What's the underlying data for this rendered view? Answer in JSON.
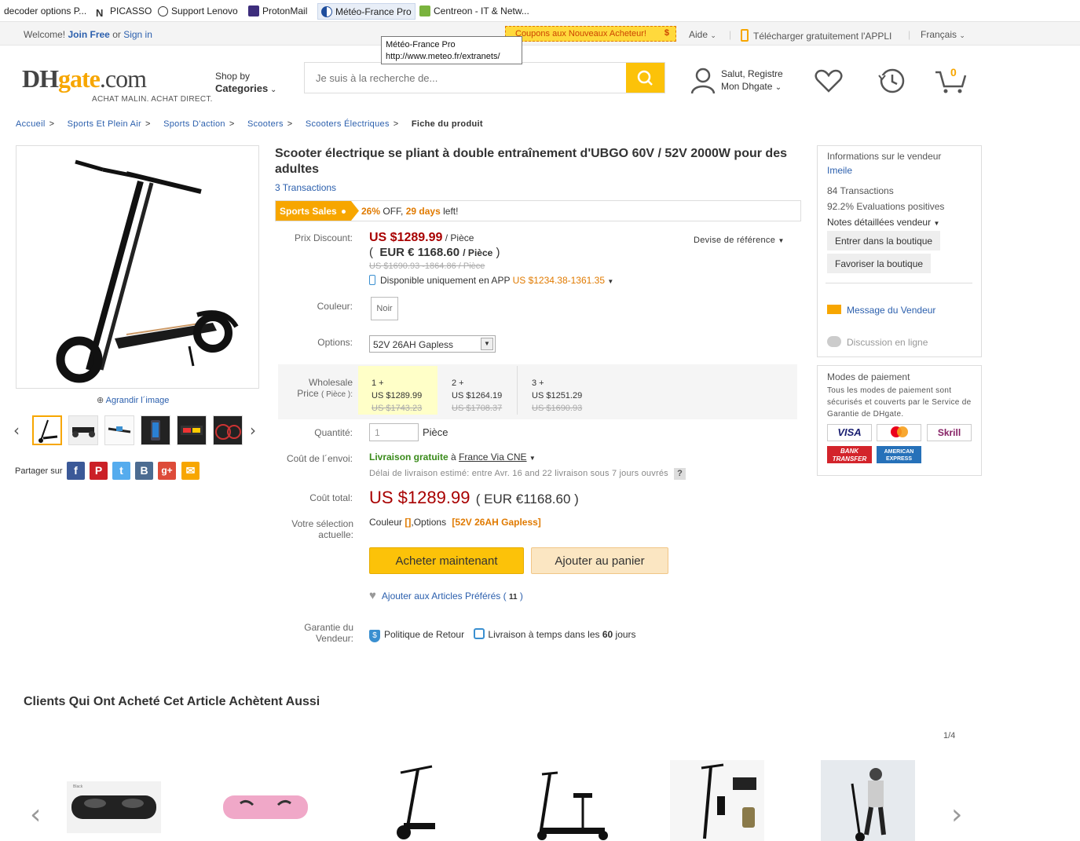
{
  "bookmarks": [
    {
      "label": "decoder options P...",
      "icon": "none"
    },
    {
      "label": "PICASSO",
      "icon": "n-logo-icon"
    },
    {
      "label": "Support Lenovo",
      "icon": "globe-icon"
    },
    {
      "label": "ProtonMail",
      "icon": "protonmail-icon"
    },
    {
      "label": "Météo-France Pro",
      "icon": "meteo-icon"
    },
    {
      "label": "Centreon - IT & Netw...",
      "icon": "centreon-icon"
    }
  ],
  "tooltip": {
    "title": "Météo-France Pro",
    "url": "http://www.meteo.fr/extranets/"
  },
  "topbar": {
    "welcome": "Welcome!",
    "join": "Join Free",
    "or": "or",
    "signin": "Sign in",
    "coupon": "Coupons aux Nouveaux Acheteur!",
    "coupon_icon": "$",
    "help": "Aide",
    "app": "Télécharger gratuitement l'APPLI",
    "language": "Français"
  },
  "header": {
    "logo_dh": "DH",
    "logo_g": "gate",
    "logo_com": ".com",
    "tagline": "ACHAT MALIN. ACHAT DIRECT.",
    "shop_by": "Shop by",
    "categories": "Categories",
    "search_placeholder": "Je suis à la recherche de...",
    "greeting": "Salut, Registre",
    "my_dhgate": "Mon Dhgate",
    "cart_count": "0"
  },
  "breadcrumb": [
    "Accueil",
    "Sports Et Plein Air",
    "Sports D'action",
    "Scooters",
    "Scooters Électriques",
    "Fiche du produit"
  ],
  "gallery": {
    "zoom": "Agrandir l´image",
    "share": "Partager sur"
  },
  "product": {
    "title": "Scooter électrique se pliant à double entraînement d'UBGO 60V / 52V 2000W pour des adultes",
    "transactions": "3 Transactions",
    "sale_tag": "Sports Sales",
    "sale_pct": "26%",
    "sale_off": "OFF,",
    "sale_days": "29 days",
    "sale_left": "left!",
    "price_label": "Prix Discount:",
    "price": "US $1289.99",
    "per": "/ Pièce",
    "price_eur": "EUR € 1168.60",
    "per_eur": "/ Pièce",
    "old_price": "US $1690.93 -1864.86 / Pièce",
    "currency_ref": "Devise de référence",
    "app_only": "Disponible uniquement en APP",
    "app_price": "US $1234.38-1361.35",
    "color_label": "Couleur:",
    "color_value": "Noir",
    "options_label": "Options:",
    "options_value": "52V 26AH Gapless",
    "wholesale_label": "Wholesale",
    "wholesale_label2": "Price",
    "wholesale_unit": "( Pièce ):",
    "tiers": [
      {
        "qty": "1 +",
        "price": "US $1289.99",
        "old": "US $1743.23"
      },
      {
        "qty": "2 +",
        "price": "US $1264.19",
        "old": "US $1708.37"
      },
      {
        "qty": "3 +",
        "price": "US $1251.29",
        "old": "US $1690.93"
      }
    ],
    "qty_label": "Quantité:",
    "qty_value": "1",
    "qty_unit": "Pièce",
    "ship_label": "Coût de l´envoi:",
    "free_ship": "Livraison gratuite",
    "ship_to": "à",
    "ship_dest": "France Via CNE",
    "delivery": "Délai de livraison estimé: entre Avr. 16 and 22 livraison sous 7 jours ouvrés",
    "total_label": "Coût total:",
    "total": "US $1289.99",
    "total_eur": "( EUR €1168.60 )",
    "selection_label": "Votre sélection actuelle:",
    "sel_color": "Couleur",
    "sel_color_val": "[]",
    "sel_opts": ",Options",
    "sel_opts_val": "[52V 26AH Gapless]",
    "buy_now": "Acheter maintenant",
    "add_cart": "Ajouter au panier",
    "wishlist": "Ajouter aux Articles Préférés",
    "wishlist_count": "11",
    "guarantee_label": "Garantie du Vendeur:",
    "return_policy": "Politique de Retour",
    "ontime": "Livraison à temps dans les",
    "ontime_days": "60",
    "ontime_unit": "jours"
  },
  "seller": {
    "heading": "Informations sur le vendeur",
    "name": "Imeile",
    "transactions": "84 Transactions",
    "positive_pct": "92.2%",
    "positive": "Evaluations positives",
    "ratings": "Notes détaillées vendeur",
    "enter_store": "Entrer dans la boutique",
    "favorite_store": "Favoriser la boutique",
    "message": "Message du Vendeur",
    "chat": "Discussion en ligne"
  },
  "payment": {
    "heading": "Modes de paiement",
    "desc": "Tous les modes de paiement sont sécurisés et couverts par le Service de Garantie de DHgate.",
    "cards": [
      "VISA",
      "mastercard",
      "Skrill",
      "BANK TRANSFER",
      "AMERICAN EXPRESS"
    ]
  },
  "also_bought": {
    "title": "Clients Qui Ont Acheté Cet Article Achètent Aussi",
    "pager": "1/4",
    "thumb_caption": "Black"
  },
  "colors": {
    "accent": "#f7a600",
    "price_red": "#a80000",
    "link": "#2b5fad",
    "buy_btn": "#fcc209",
    "cart_btn": "#fbe6c2"
  }
}
